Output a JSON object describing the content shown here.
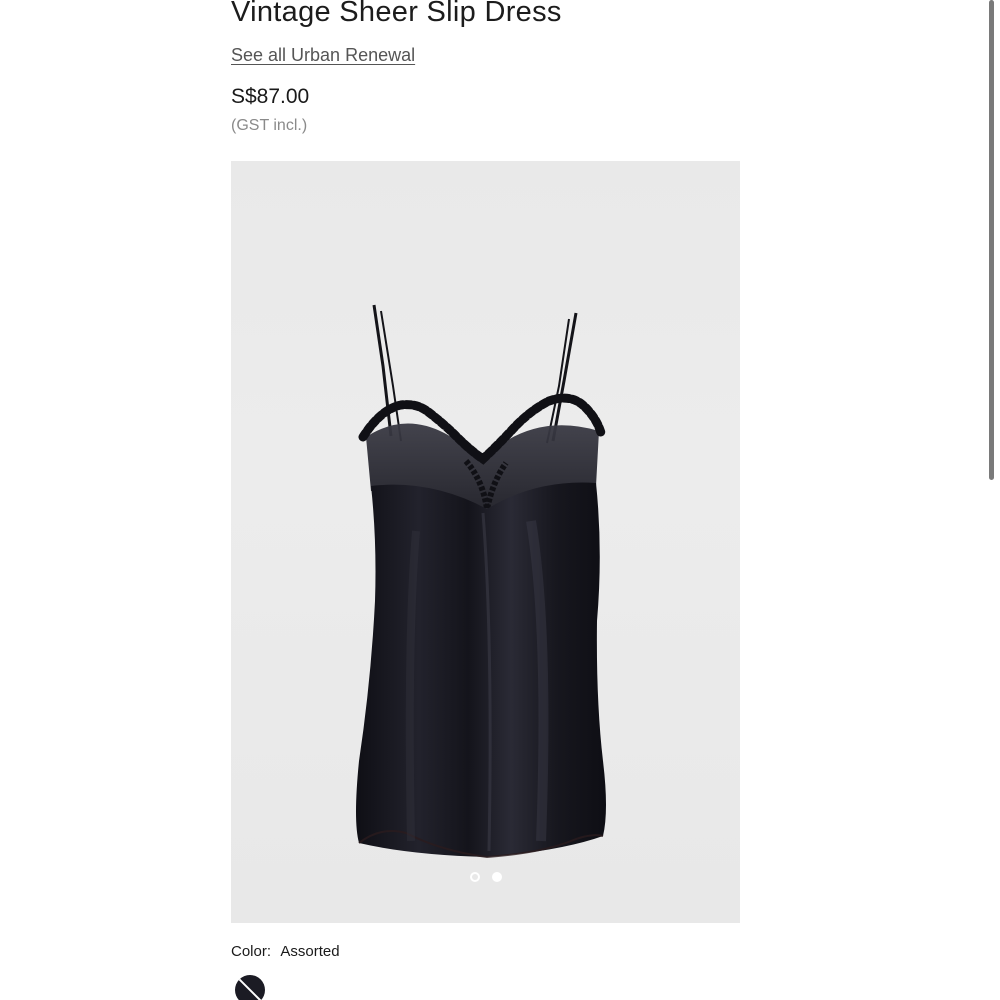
{
  "product": {
    "title": "Vintage Sheer Slip Dress",
    "brand_link": "See all Urban Renewal",
    "price": "S$87.00",
    "tax_note": "(GST incl.)"
  },
  "gallery": {
    "image_icon": "black-satin-slip-dress-image",
    "slide_count": 2,
    "active_slide": 2
  },
  "color": {
    "label": "Color:",
    "value": "Assorted",
    "swatch_color": "#1b1b24"
  },
  "colors": {
    "background": "#ffffff",
    "text": "#1a1a1a",
    "muted_text": "#8a8a8a",
    "image_background": "#ebebeb",
    "dress": "#15151c"
  }
}
